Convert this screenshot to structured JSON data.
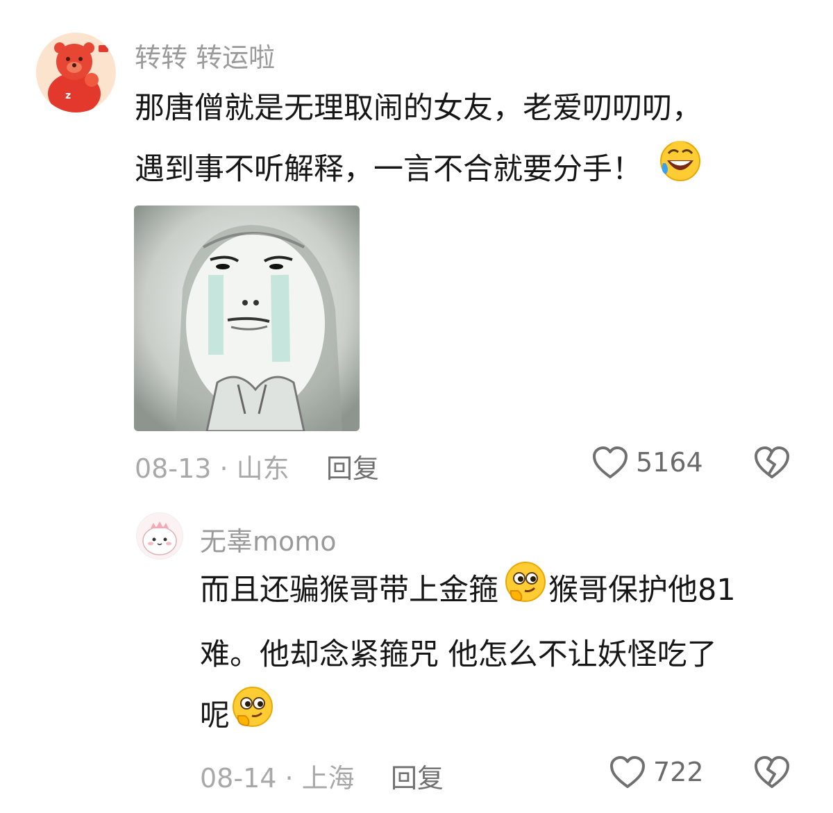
{
  "comment": {
    "username": "转转 转运啦",
    "lines": [
      "那唐僧就是无理取闹的女友，老爱叨叨叨，",
      "遇到事不听解释，一言不合就要分手！"
    ],
    "emoji": "laughing-crying-emoji",
    "image_alt": "crying-face-meme",
    "date_location": "08-13 · 山东",
    "reply_label": "回复",
    "like_count": "5164"
  },
  "reply": {
    "username": "无辜momo",
    "line1_part1": "而且还骗猴哥带上金箍",
    "line1_part2": "猴哥保护他81",
    "line2": "难。他却念紧箍咒 他怎么不让妖怪吃了",
    "line3": "呢",
    "emoji": "thinking-smirk-emoji",
    "date_location": "08-14 · 上海",
    "reply_label": "回复",
    "like_count": "722"
  },
  "colors": {
    "background": "#ffffff",
    "username": "#9a9a9a",
    "text": "#161616",
    "meta": "#a8a8a8",
    "icon": "#707070"
  }
}
